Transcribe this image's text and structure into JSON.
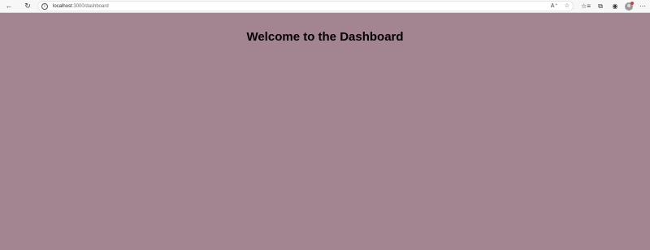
{
  "browser": {
    "url_host": "localhost",
    "url_path": ":3000/dashboard",
    "icons": {
      "back": "back-arrow-icon",
      "reload": "reload-icon",
      "info": "info-icon",
      "read_aloud": "read-aloud-icon",
      "favorite": "star-icon",
      "favorites": "favorites-icon",
      "collections": "collections-icon",
      "extension": "extension-icon",
      "profile": "profile-avatar",
      "menu": "more-menu-icon"
    }
  },
  "page": {
    "title": "Welcome to the Dashboard",
    "background_color": "#a38592"
  }
}
